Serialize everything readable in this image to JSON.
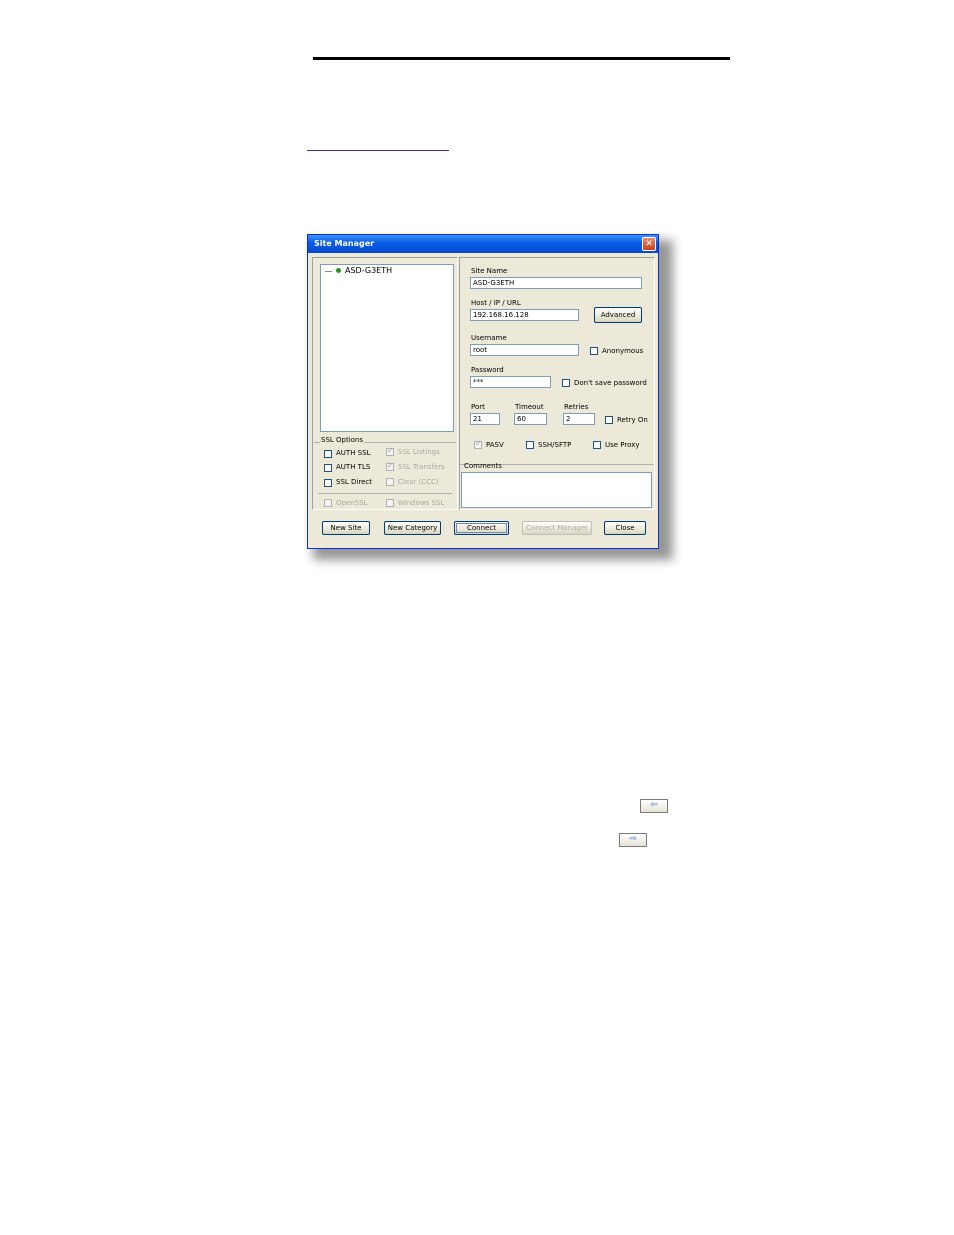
{
  "window": {
    "title": "Site Manager",
    "close_glyph": "✕"
  },
  "tree": {
    "items": [
      {
        "label": "ASD-G3ETH"
      }
    ]
  },
  "fields": {
    "site_name_label": "Site Name",
    "site_name_value": "ASD-G3ETH",
    "host_label": "Host / IP / URL",
    "host_value": "192.168.16.128",
    "advanced_label": "Advanced",
    "username_label": "Username",
    "username_value": "root",
    "anonymous_label": "Anonymous",
    "password_label": "Password",
    "password_value": "***",
    "dont_save_label": "Don't save password",
    "port_label": "Port",
    "port_value": "21",
    "timeout_label": "Timeout",
    "timeout_value": "60",
    "retries_label": "Retries",
    "retries_value": "2",
    "retry_on_label": "Retry On",
    "pasv_label": "PASV",
    "ssh_sftp_label": "SSH/SFTP",
    "use_proxy_label": "Use Proxy",
    "comments_label": "Comments"
  },
  "ssl": {
    "group_label": "SSL Options",
    "auth_ssl": "AUTH SSL",
    "auth_tls": "AUTH TLS",
    "ssl_direct": "SSL Direct",
    "ssl_listings": "SSL Listings",
    "ssl_transfers": "SSL Transfers",
    "clear_ccc": "Clear (CCC)",
    "openssl": "OpenSSL",
    "windows_ssl": "Windows SSL"
  },
  "buttons": {
    "new_site": "New Site",
    "new_category": "New Category",
    "connect": "Connect",
    "connect_manager": "Connect Manager",
    "close": "Close"
  },
  "icons": {
    "left_arrow": "⇦",
    "right_arrow": "⇨"
  },
  "colors": {
    "titlebar": "#0a5fe4",
    "dialog_bg": "#ece9d8"
  }
}
